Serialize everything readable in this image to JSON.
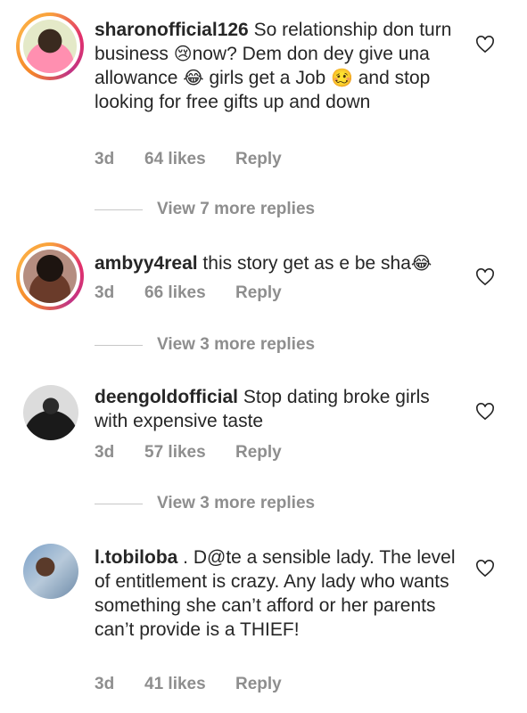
{
  "comments": [
    {
      "username": "sharonofficial126",
      "text_before": " So relationship don turn business ",
      "emoji1": "😢",
      "text_mid": "now? Dem don dey give una allowance ",
      "emoji2": "😂",
      "text_mid2": " girls get a Job ",
      "emoji3": "🥴",
      "text_after": " and stop looking for free gifts up and down",
      "time": "3d",
      "likes": "64 likes",
      "reply": "Reply",
      "view_replies": "View 7 more replies"
    },
    {
      "username": "ambyy4real",
      "text_before": " this story get as e be sha",
      "emoji1": "😂",
      "time": "3d",
      "likes": "66 likes",
      "reply": "Reply",
      "view_replies": "View 3 more replies"
    },
    {
      "username": "deengoldofficial",
      "text_before": " Stop dating broke girls with expensive taste",
      "time": "3d",
      "likes": "57 likes",
      "reply": "Reply",
      "view_replies": "View 3 more replies"
    },
    {
      "username": "l.tobiloba",
      "text_before": " . D@te a sensible lady. The level of entitlement is crazy. Any lady who wants something she can’t afford or her parents can’t provide is a THIEF!",
      "time": "3d",
      "likes": "41 likes",
      "reply": "Reply"
    }
  ],
  "icons": {
    "like": "heart-outline-icon",
    "avatar": "profile-photo"
  },
  "colors": {
    "text": "#262626",
    "meta": "#8e8e8e",
    "ring_start": "#f9a23b",
    "ring_end": "#c13584"
  }
}
